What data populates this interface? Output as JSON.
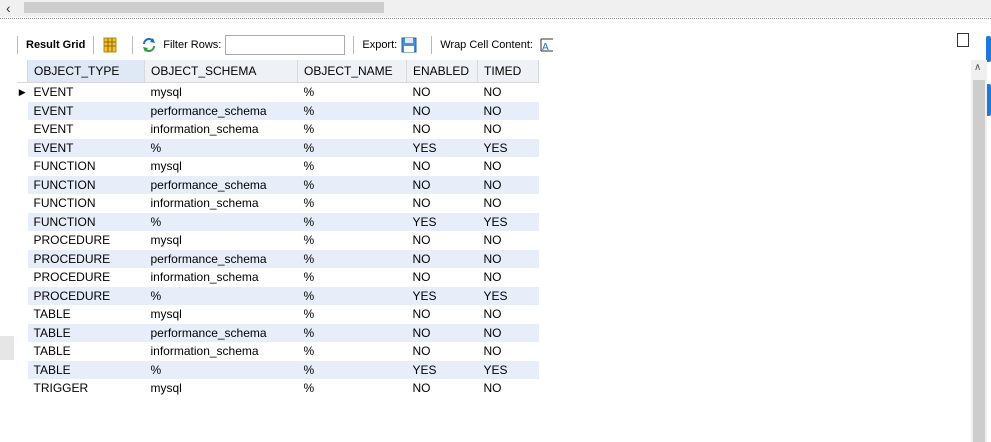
{
  "toolbar": {
    "result_grid": "Result Grid",
    "filter_rows": "Filter Rows:",
    "filter_value": "",
    "export": "Export:",
    "wrap_cell": "Wrap Cell Content:"
  },
  "table": {
    "columns": [
      "OBJECT_TYPE",
      "OBJECT_SCHEMA",
      "OBJECT_NAME",
      "ENABLED",
      "TIMED"
    ],
    "rows": [
      [
        "EVENT",
        "mysql",
        "%",
        "NO",
        "NO"
      ],
      [
        "EVENT",
        "performance_schema",
        "%",
        "NO",
        "NO"
      ],
      [
        "EVENT",
        "information_schema",
        "%",
        "NO",
        "NO"
      ],
      [
        "EVENT",
        "%",
        "%",
        "YES",
        "YES"
      ],
      [
        "FUNCTION",
        "mysql",
        "%",
        "NO",
        "NO"
      ],
      [
        "FUNCTION",
        "performance_schema",
        "%",
        "NO",
        "NO"
      ],
      [
        "FUNCTION",
        "information_schema",
        "%",
        "NO",
        "NO"
      ],
      [
        "FUNCTION",
        "%",
        "%",
        "YES",
        "YES"
      ],
      [
        "PROCEDURE",
        "mysql",
        "%",
        "NO",
        "NO"
      ],
      [
        "PROCEDURE",
        "performance_schema",
        "%",
        "NO",
        "NO"
      ],
      [
        "PROCEDURE",
        "information_schema",
        "%",
        "NO",
        "NO"
      ],
      [
        "PROCEDURE",
        "%",
        "%",
        "YES",
        "YES"
      ],
      [
        "TABLE",
        "mysql",
        "%",
        "NO",
        "NO"
      ],
      [
        "TABLE",
        "performance_schema",
        "%",
        "NO",
        "NO"
      ],
      [
        "TABLE",
        "information_schema",
        "%",
        "NO",
        "NO"
      ],
      [
        "TABLE",
        "%",
        "%",
        "YES",
        "YES"
      ],
      [
        "TRIGGER",
        "mysql",
        "%",
        "NO",
        "NO"
      ]
    ],
    "current_row_marker": "▶"
  },
  "colors": {
    "alt_row": "#e7eef9",
    "accent": "#1e7ad6"
  }
}
